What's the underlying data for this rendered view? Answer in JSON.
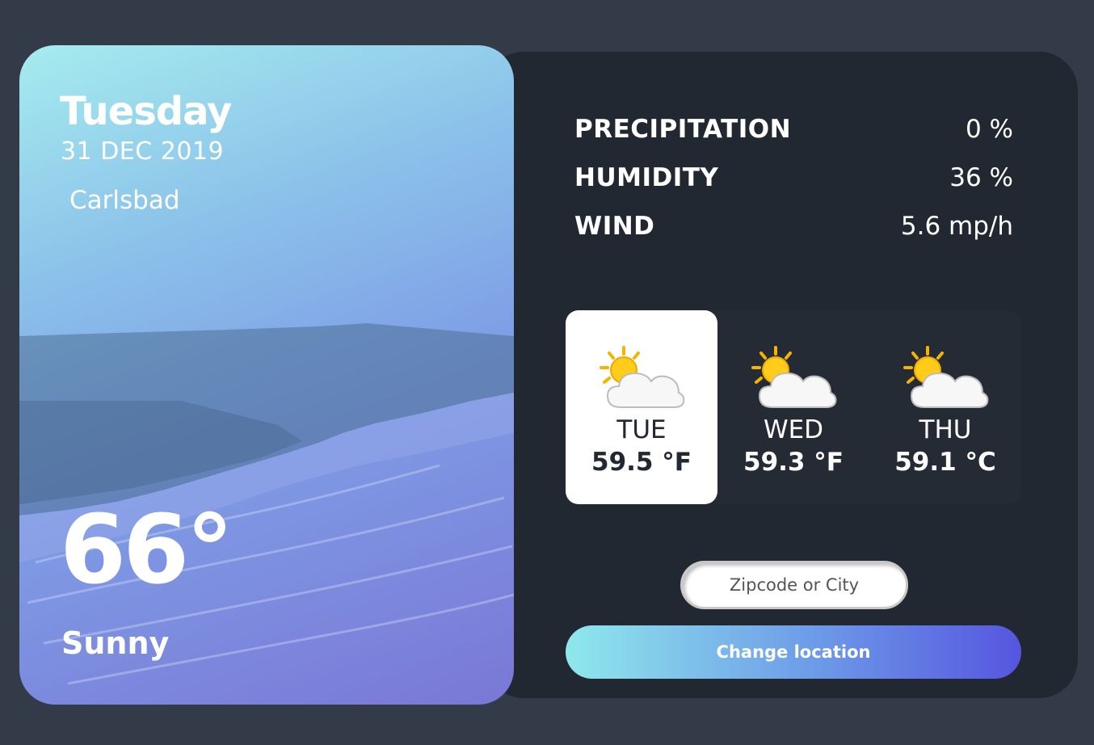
{
  "today": {
    "day": "Tuesday",
    "date": "31 DEC 2019",
    "location": "Carlsbad",
    "temperature": "66°",
    "condition": "Sunny"
  },
  "stats": [
    {
      "label": "PRECIPITATION",
      "value": "0 %"
    },
    {
      "label": "HUMIDITY",
      "value": "36 %"
    },
    {
      "label": "WIND",
      "value": "5.6 mp/h"
    }
  ],
  "forecast": [
    {
      "day": "TUE",
      "temp": "59.5 °F",
      "icon": "partly-cloudy-icon",
      "active": true
    },
    {
      "day": "WED",
      "temp": "59.3 °F",
      "icon": "partly-cloudy-icon",
      "active": false
    },
    {
      "day": "THU",
      "temp": "59.1 °C",
      "icon": "partly-cloudy-icon",
      "active": false
    }
  ],
  "search": {
    "placeholder": "Zipcode or City",
    "value": ""
  },
  "change_button": {
    "label": "Change location"
  },
  "colors": {
    "page_bg": "#343b48",
    "panel_bg": "#222831",
    "accent_start": "#8fe8ec",
    "accent_end": "#5655df"
  }
}
